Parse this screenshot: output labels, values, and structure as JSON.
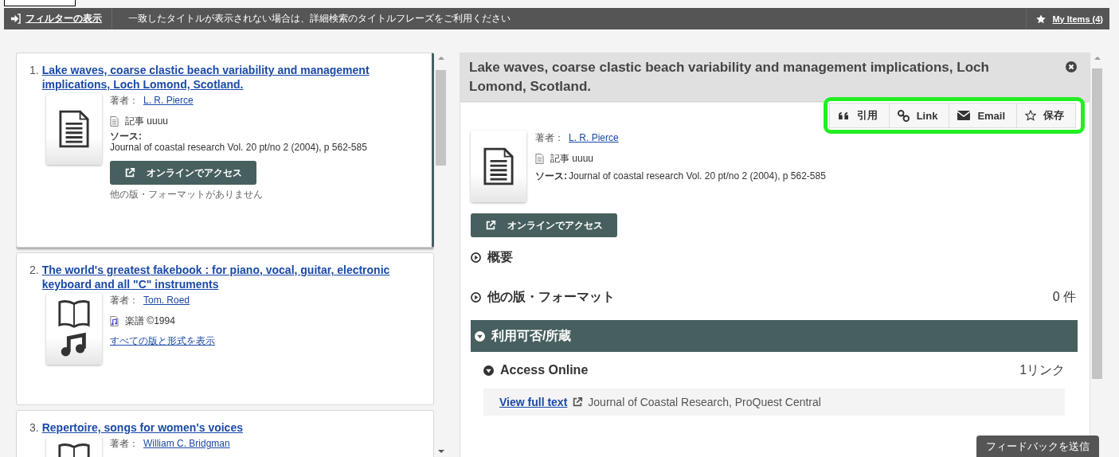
{
  "filter_bar": {
    "filter_link": "フィルターの表示",
    "message": "一致したタイトルが表示されない場合は、詳細検索のタイトルフレーズをご利用ください",
    "my_items": "My Items (4)"
  },
  "results": [
    {
      "number": "1.",
      "title": "Lake waves, coarse clastic beach variability and management implications, Loch Lomond, Scotland.",
      "kind": "article",
      "selected": true,
      "author_label": "著者：",
      "author": "L. R. Pierce",
      "format": "記事 uuuu",
      "source_label": "ソース:",
      "source": "Journal of coastal research Vol. 20 pt/no 2 (2004), p 562-585",
      "access_button": "オンラインでアクセス",
      "note": "他の版・フォーマットがありません"
    },
    {
      "number": "2.",
      "title": "The world's greatest fakebook : for piano, vocal, guitar, electronic keyboard and all \"C\" instruments",
      "kind": "score",
      "selected": false,
      "author_label": "著者：",
      "author": "Tom. Roed",
      "format": "楽譜 ©1994",
      "versions_link": "すべての版と形式を表示"
    },
    {
      "number": "3.",
      "title": "Repertoire, songs for women's voices",
      "kind": "score",
      "selected": false,
      "author_label": "著者：",
      "author": "William C. Bridgman"
    }
  ],
  "detail": {
    "title": "Lake waves, coarse clastic beach variability and management implications, Loch Lomond, Scotland.",
    "actions": [
      {
        "kind": "cite",
        "label": "引用"
      },
      {
        "kind": "link",
        "label": "Link"
      },
      {
        "kind": "email",
        "label": "Email"
      },
      {
        "kind": "save",
        "label": "保存"
      }
    ],
    "author_label": "著者：",
    "author": "L. R. Pierce",
    "format": "記事 uuuu",
    "source_label": "ソース:",
    "source": "Journal of coastal research Vol. 20 pt/no 2 (2004), p 562-585",
    "access_button": "オンラインでアクセス",
    "sections": [
      {
        "label": "概要",
        "expanded": false
      },
      {
        "label": "他の版・フォーマット",
        "count": "0 件",
        "expanded": false
      },
      {
        "label": "利用可否/所蔵",
        "expanded": true
      }
    ],
    "access_online": {
      "label": "Access Online",
      "count": "1リンク",
      "expanded": true,
      "link": "View full text",
      "link_source": "Journal of Coastal Research, ProQuest Central"
    }
  },
  "feedback_button": "フィードバックを送信"
}
